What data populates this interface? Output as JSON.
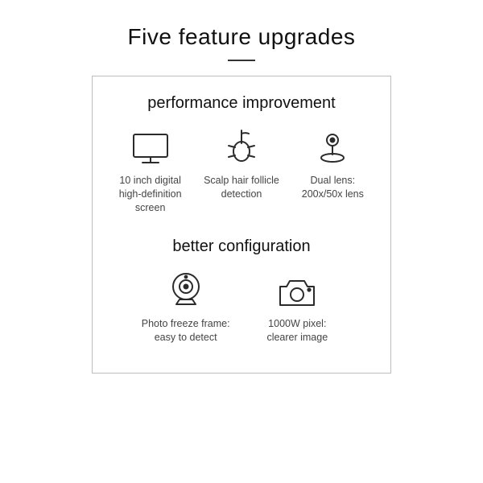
{
  "title": "Five feature upgrades",
  "section1": {
    "heading": "performance improvement",
    "features": [
      {
        "icon": "monitor-icon",
        "caption": "10 inch digital\nhigh-definition\nscreen"
      },
      {
        "icon": "follicle-icon",
        "caption": "Scalp hair follicle\ndetection"
      },
      {
        "icon": "dual-lens-icon",
        "caption": "Dual lens:\n200x/50x lens"
      }
    ]
  },
  "section2": {
    "heading": "better configuration",
    "features": [
      {
        "icon": "webcam-icon",
        "caption": "Photo freeze frame:\neasy to detect"
      },
      {
        "icon": "camera-icon",
        "caption": "1000W pixel:\nclearer image"
      }
    ]
  }
}
